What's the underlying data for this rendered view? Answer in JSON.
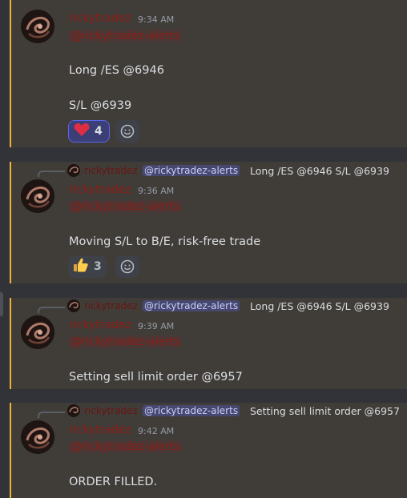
{
  "accent": {
    "highlight_bar": "#f0b232",
    "username": "#8e1b16",
    "mention": "#c9cdfb"
  },
  "messages": [
    {
      "username": "rickytradez",
      "time": "9:34 AM",
      "mention": "@rickytradez-alerts",
      "lines": [
        "Long /ES @6946",
        "S/L @6939"
      ],
      "reactions": [
        {
          "icon": "heart-icon",
          "count": "4"
        }
      ]
    },
    {
      "reply": {
        "username": "rickytradez",
        "mention": "@rickytradez-alerts",
        "text": "Long /ES @6946  S/L @6939"
      },
      "username": "rickytradez",
      "time": "9:36 AM",
      "mention": "@rickytradez-alerts",
      "lines": [
        "Moving S/L to B/E, risk-free trade"
      ],
      "reactions": [
        {
          "icon": "thumbs-up-icon",
          "count": "3"
        }
      ]
    },
    {
      "reply": {
        "username": "rickytradez",
        "mention": "@rickytradez-alerts",
        "text": "Long /ES @6946  S/L @6939"
      },
      "username": "rickytradez",
      "time": "9:39 AM",
      "mention": "@rickytradez-alerts",
      "lines": [
        "Setting sell limit order @6957"
      ]
    },
    {
      "reply": {
        "username": "rickytradez",
        "mention": "@rickytradez-alerts",
        "text": "Setting sell limit order @6957"
      },
      "username": "rickytradez",
      "time": "9:42 AM",
      "mention": "@rickytradez-alerts",
      "lines": [
        "ORDER FILLED."
      ]
    }
  ]
}
